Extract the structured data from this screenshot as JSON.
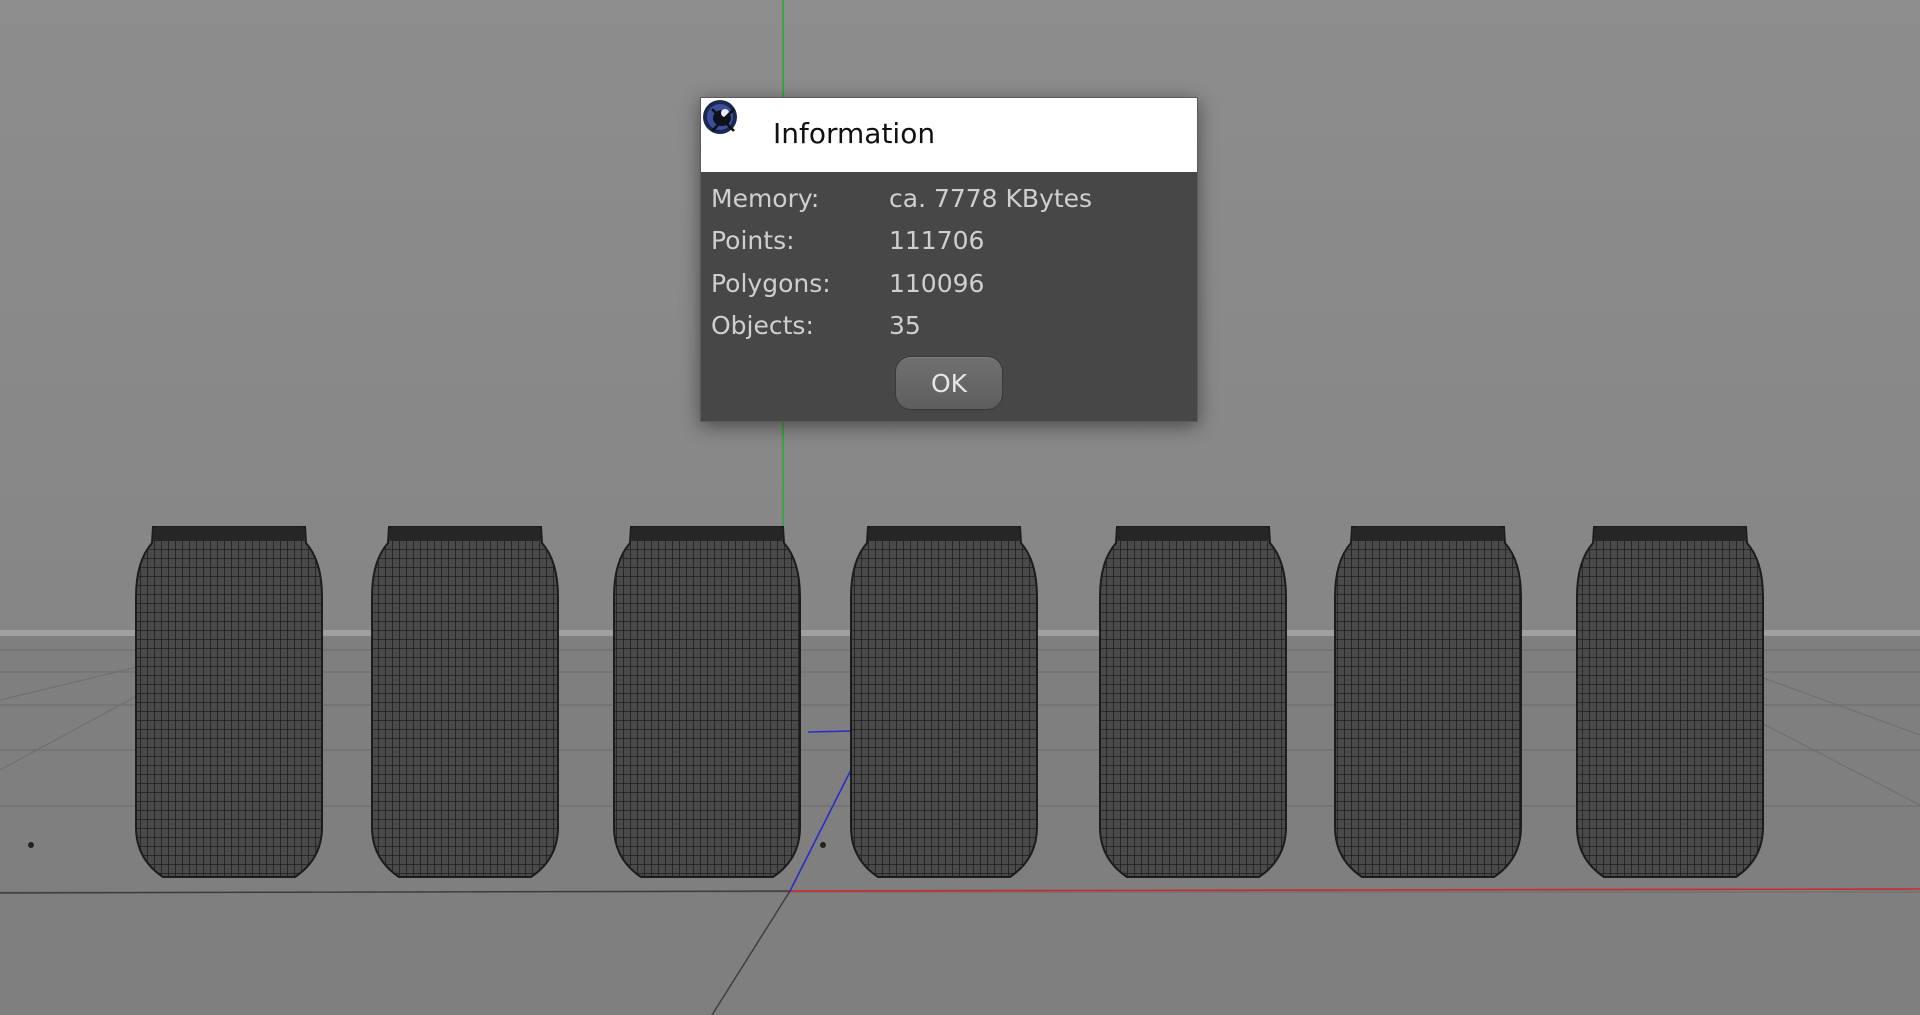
{
  "dialog": {
    "title": "Information",
    "app_icon": "cinema4d-logo-icon",
    "close_icon": "close-icon",
    "rows": [
      {
        "label": "Memory:",
        "value": "ca. 7778 KBytes"
      },
      {
        "label": "Points:",
        "value": "111706"
      },
      {
        "label": "Polygons:",
        "value": "110096"
      },
      {
        "label": "Objects:",
        "value": "35"
      }
    ],
    "ok_label": "OK"
  },
  "viewport": {
    "object_count_shown": 7,
    "colors": {
      "background": "#8a8a8a",
      "floor": "#7d7d7d",
      "mesh": "#2a2a2a",
      "axis_x": "#cc2a2a",
      "axis_y": "#2ea82e",
      "axis_z": "#2a2ad0"
    }
  }
}
